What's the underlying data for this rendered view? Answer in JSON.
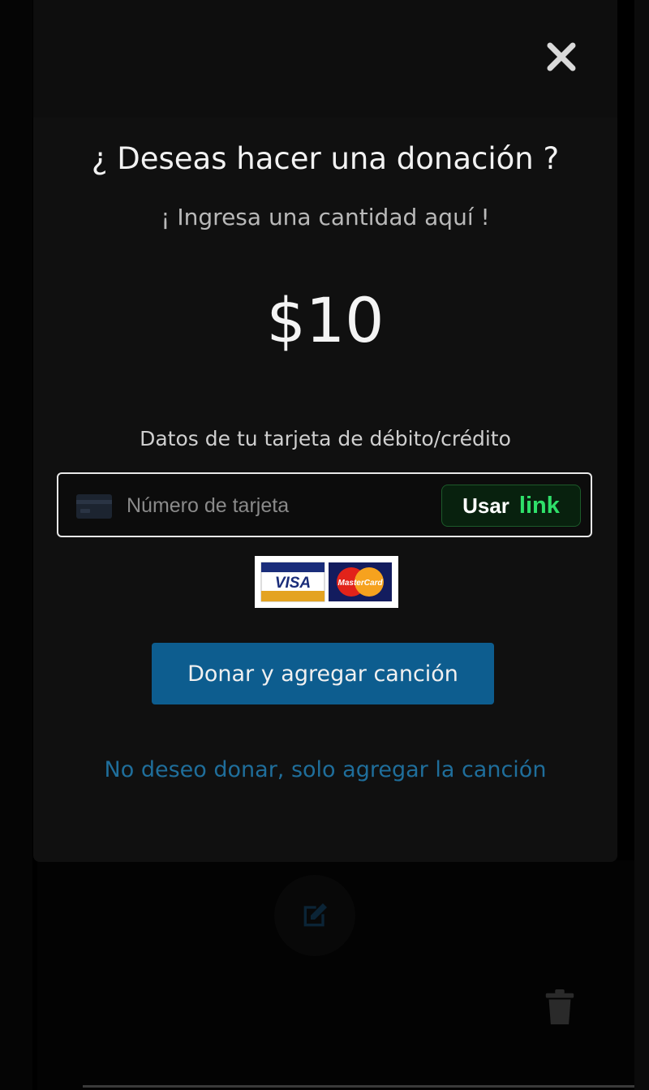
{
  "modal": {
    "title": "¿ Deseas hacer una donación ?",
    "subtitle": "¡ Ingresa una cantidad aquí !",
    "amount": "$10",
    "card_label": "Datos de tu tarjeta de débito/crédito",
    "card_placeholder": "Número de tarjeta",
    "link_button": {
      "usar": "Usar",
      "link": "link"
    },
    "payment_logos": {
      "visa": "VISA",
      "mastercard": "MasterCard"
    },
    "donate_button": "Donar y agregar canción",
    "skip_link": "No deseo donar, solo agregar la canción"
  },
  "icons": {
    "close": "close-icon",
    "card": "credit-card-icon",
    "edit": "edit-icon",
    "trash": "trash-icon"
  },
  "colors": {
    "modal_bg": "#101010",
    "primary_button": "#0d5d8f",
    "skip_link": "#1f6e9b",
    "link_green": "#2fe06a"
  }
}
